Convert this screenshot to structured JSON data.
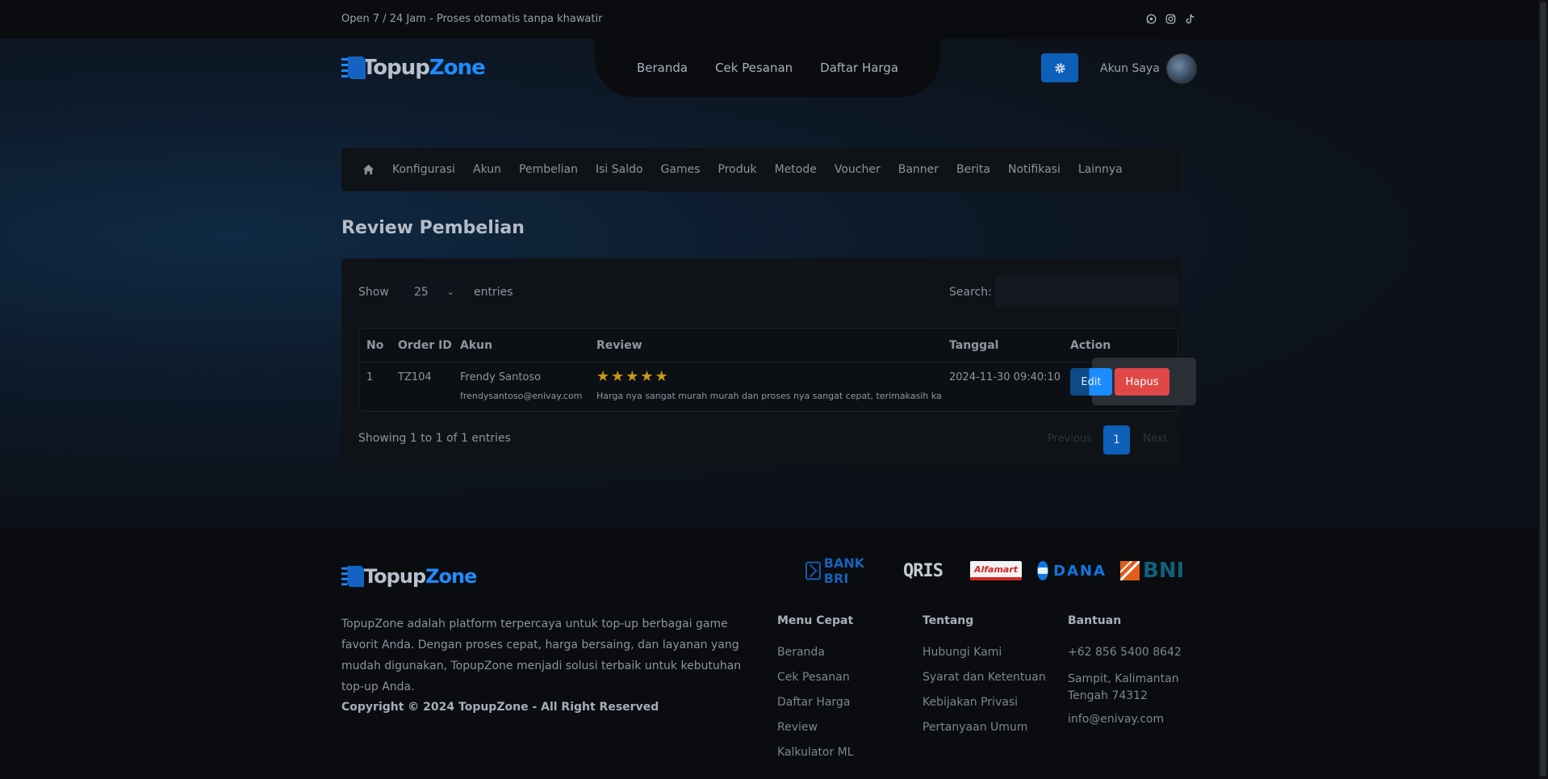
{
  "topbar": {
    "text": "Open 7 / 24 Jam - Proses otomatis tanpa khawatir",
    "socials": [
      "whatsapp-icon",
      "instagram-icon",
      "tiktok-icon"
    ]
  },
  "brand": {
    "part1": "Topup",
    "part2": "Zone",
    "accent": "#1f8bff"
  },
  "nav": {
    "beranda": "Beranda",
    "cek_pesanan": "Cek Pesanan",
    "daftar_harga": "Daftar Harga"
  },
  "header": {
    "account_label": "Akun Saya"
  },
  "admin_menu": [
    "Konfigurasi",
    "Akun",
    "Pembelian",
    "Isi Saldo",
    "Games",
    "Produk",
    "Metode",
    "Voucher",
    "Banner",
    "Berita",
    "Notifikasi",
    "Lainnya"
  ],
  "page": {
    "title": "Review Pembelian"
  },
  "table_controls": {
    "show_label": "Show",
    "entries_value": "25",
    "entries_label": "entries",
    "search_label": "Search:",
    "search_value": ""
  },
  "table": {
    "headers": {
      "no": "No",
      "order_id": "Order ID",
      "akun": "Akun",
      "review": "Review",
      "tanggal": "Tanggal",
      "action": "Action"
    },
    "rows": [
      {
        "no": "1",
        "order_id": "TZ104",
        "name": "Frendy Santoso",
        "email": "frendysantoso@enivay.com",
        "rating": 5,
        "review": "Harga nya sangat murah murah dan proses nya sangat cepat, terimakasih ka",
        "tanggal": "2024-11-30 09:40:10",
        "edit": "Edit",
        "hapus": "Hapus"
      }
    ]
  },
  "pagination": {
    "info": "Showing 1 to 1 of 1 entries",
    "previous": "Previous",
    "current": "1",
    "next": "Next"
  },
  "footer": {
    "payment_logos": [
      "BANK BRI",
      "QRIS",
      "Alfamart",
      "DANA",
      "BNI"
    ],
    "description": "TopupZone adalah platform terpercaya untuk top-up berbagai game favorit Anda. Dengan proses cepat, harga bersaing, dan layanan yang mudah digunakan, TopupZone menjadi solusi terbaik untuk kebutuhan top-up Anda.",
    "copyright": "Copyright © 2024 TopupZone - All Right Reserved",
    "menu_cepat": {
      "title": "Menu Cepat",
      "links": [
        "Beranda",
        "Cek Pesanan",
        "Daftar Harga",
        "Review",
        "Kalkulator ML"
      ]
    },
    "tentang": {
      "title": "Tentang",
      "links": [
        "Hubungi Kami",
        "Syarat dan Ketentuan",
        "Kebijakan Privasi",
        "Pertanyaan Umum"
      ]
    },
    "bantuan": {
      "title": "Bantuan",
      "phone": "+62 856 5400 8642",
      "address": "Sampit, Kalimantan Tengah 74312",
      "email": "info@enivay.com"
    }
  }
}
